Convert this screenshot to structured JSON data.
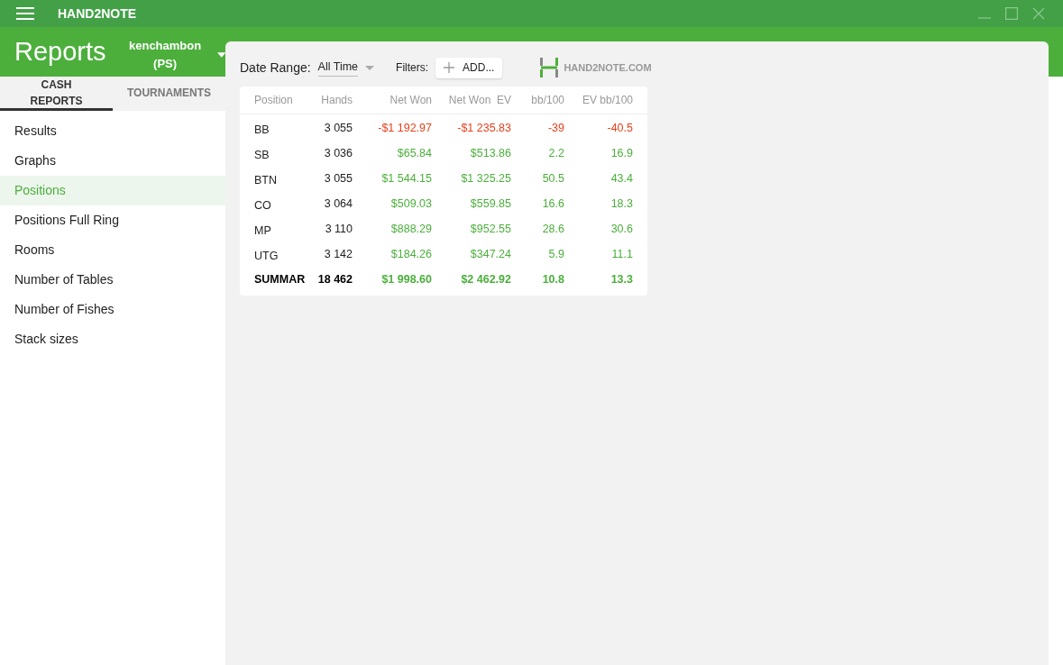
{
  "app_title": "HAND2NOTE",
  "header": {
    "title": "Reports",
    "account": "kenchambon (PS)"
  },
  "tabs": [
    {
      "label": "CASH REPORTS",
      "selected": true
    },
    {
      "label": "TOURNAMENTS",
      "selected": false
    }
  ],
  "sidebar": {
    "items": [
      {
        "label": "Results",
        "selected": false
      },
      {
        "label": "Graphs",
        "selected": false
      },
      {
        "label": "Positions",
        "selected": true
      },
      {
        "label": "Positions Full Ring",
        "selected": false
      },
      {
        "label": "Rooms",
        "selected": false
      },
      {
        "label": "Number of Tables",
        "selected": false
      },
      {
        "label": "Number of Fishes",
        "selected": false
      },
      {
        "label": "Stack sizes",
        "selected": false
      }
    ]
  },
  "toolbar": {
    "date_range_label": "Date Range:",
    "date_range_value": "All Time",
    "filters_label": "Filters:",
    "add_button": "ADD...",
    "logo_text": "HAND2NOTE.COM"
  },
  "table": {
    "columns": [
      "Position",
      "Hands",
      "Net Won",
      "Net Won  EV",
      "bb/100",
      "EV bb/100"
    ],
    "rows": [
      {
        "kind": "loss",
        "cells": [
          "BB",
          "3 055",
          "-$1 192.97",
          "-$1 235.83",
          "-39",
          "-40.5"
        ]
      },
      {
        "kind": "gain",
        "cells": [
          "SB",
          "3 036",
          "$65.84",
          "$513.86",
          "2.2",
          "16.9"
        ]
      },
      {
        "kind": "gain",
        "cells": [
          "BTN",
          "3 055",
          "$1 544.15",
          "$1 325.25",
          "50.5",
          "43.4"
        ]
      },
      {
        "kind": "gain",
        "cells": [
          "CO",
          "3 064",
          "$509.03",
          "$559.85",
          "16.6",
          "18.3"
        ]
      },
      {
        "kind": "gain",
        "cells": [
          "MP",
          "3 110",
          "$888.29",
          "$952.55",
          "28.6",
          "30.6"
        ]
      },
      {
        "kind": "gain",
        "cells": [
          "UTG",
          "3 142",
          "$184.26",
          "$347.24",
          "5.9",
          "11.1"
        ]
      },
      {
        "kind": "total",
        "cells": [
          "SUMMAR",
          "18 462",
          "$1 998.60",
          "$2 462.92",
          "10.8",
          "13.3"
        ]
      }
    ]
  }
}
